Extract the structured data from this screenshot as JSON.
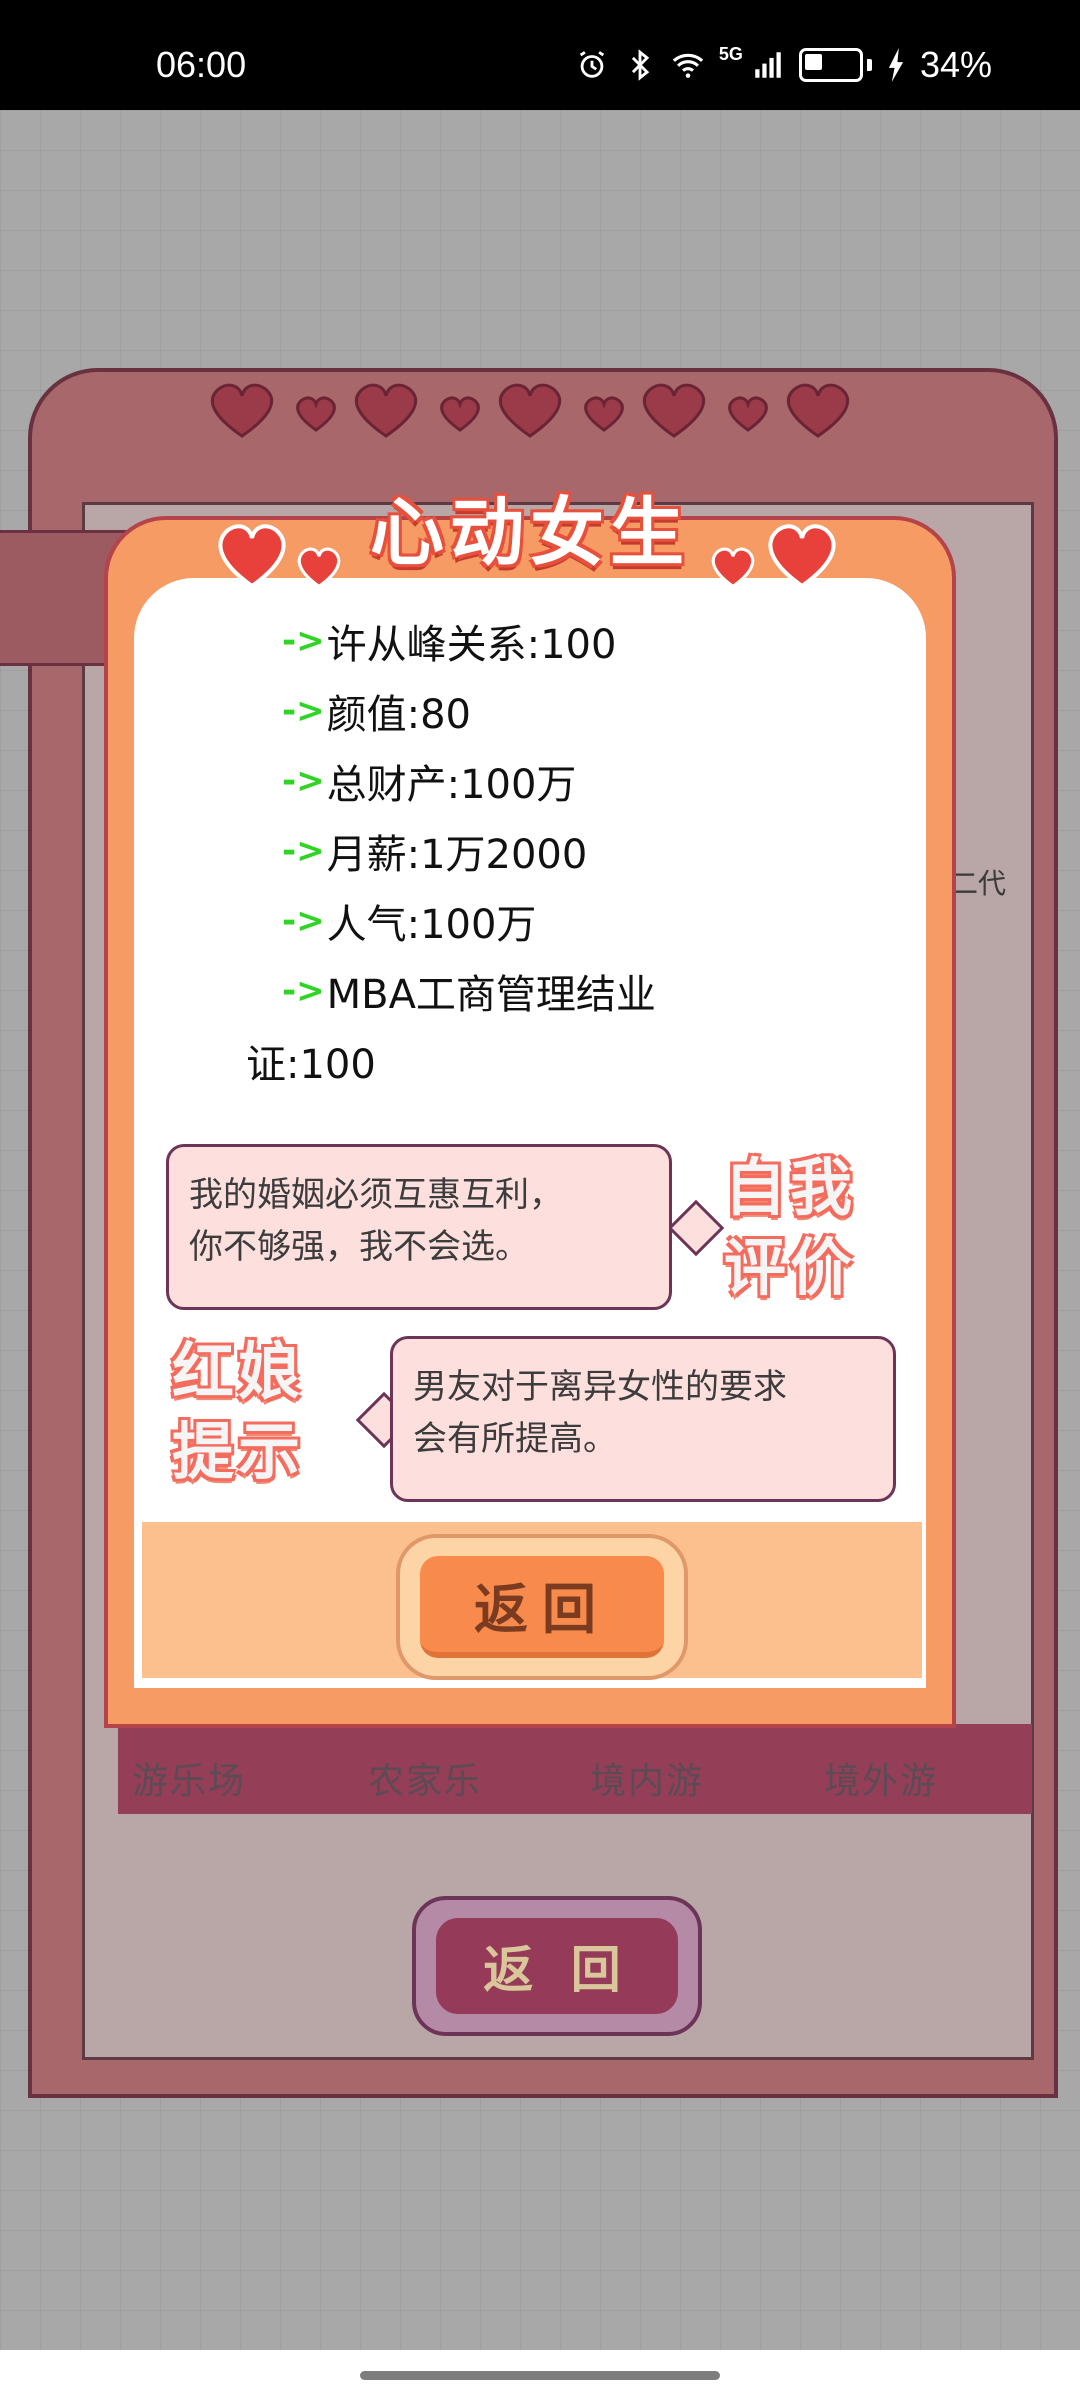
{
  "status_bar": {
    "time": "06:00",
    "network": "5G",
    "battery": "34%"
  },
  "background": {
    "side_text": "二代",
    "locations": [
      "游乐场",
      "农家乐",
      "境内游",
      "境外游"
    ],
    "return_label": "返 回"
  },
  "modal": {
    "title": "心动女生",
    "stats": [
      "许从峰关系:100",
      "颜值:80",
      "总财产:100万",
      "月薪:1万2000",
      "人气:100万",
      "MBA工商管理结业"
    ],
    "stat_continuation": "证:100",
    "self_eval": {
      "label_line1": "自我",
      "label_line2": "评价",
      "line1": "我的婚姻必须互惠互利，",
      "line2": "你不够强，我不会选。"
    },
    "matchmaker": {
      "label_line1": "红娘",
      "label_line2": "提示",
      "line1": "男友对于离异女性的要求",
      "line2": "会有所提高。"
    },
    "return_label": "返回"
  },
  "colors": {
    "modal_orange": "#f59b63",
    "heart_red": "#e8413c",
    "arrow_green": "#2fd424",
    "bubble_bg": "#fde0de"
  }
}
